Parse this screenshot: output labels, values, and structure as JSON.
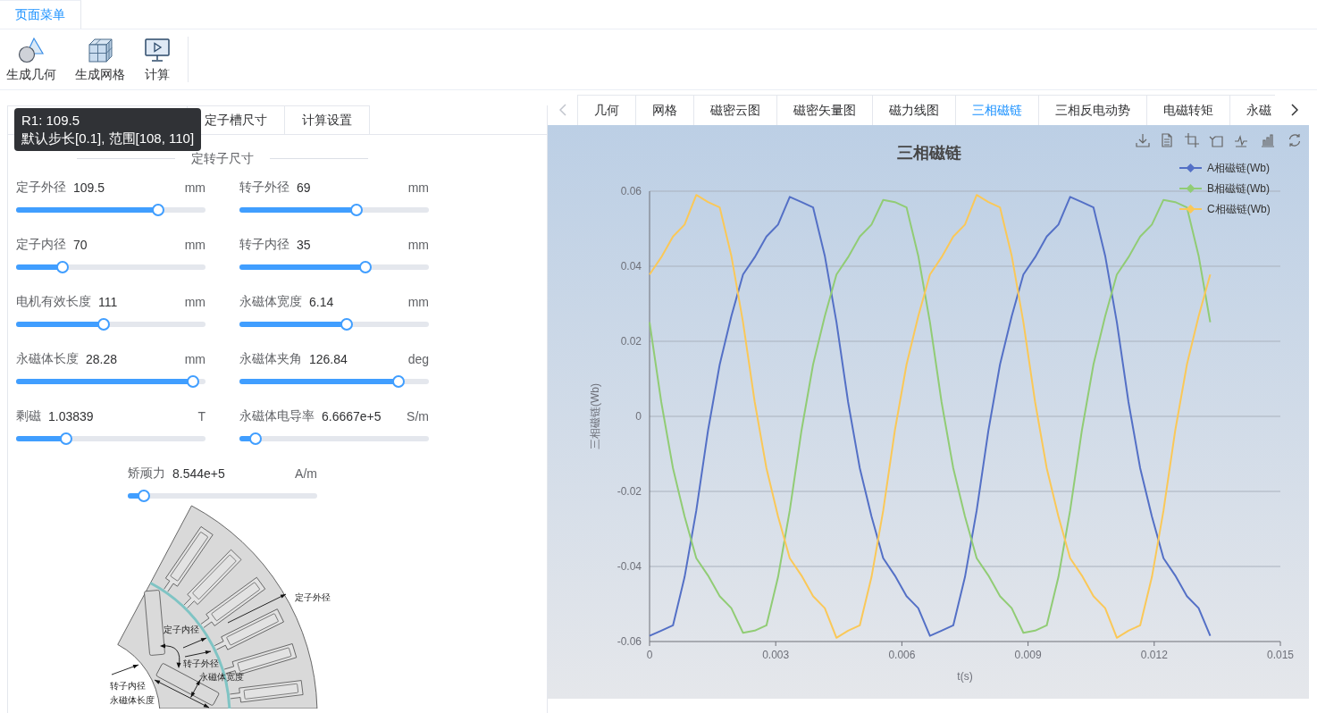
{
  "menu_tabs": [
    {
      "label": "页面菜单",
      "selected": true
    }
  ],
  "toolbar": [
    {
      "kind": "geometry",
      "label": "生成几何"
    },
    {
      "kind": "mesh",
      "label": "生成网格"
    },
    {
      "kind": "compute",
      "label": "计算"
    }
  ],
  "left_panel": {
    "tabs": [
      {
        "label": "定子槽尺寸",
        "selected": false
      },
      {
        "label": "计算设置",
        "selected": false
      }
    ],
    "tooltip": {
      "title": "R1: 109.5",
      "text": "默认步长[0.1], 范围[108, 110]"
    },
    "section_title": "定转子尺寸",
    "sliders": [
      {
        "name": "定子外径",
        "value": "109.5",
        "unit": "mm",
        "level": 0.75
      },
      {
        "name": "转子外径",
        "value": "69",
        "unit": "mm",
        "level": 0.62
      },
      {
        "name": "定子内径",
        "value": "70",
        "unit": "mm",
        "level": 0.245
      },
      {
        "name": "转子内径",
        "value": "35",
        "unit": "mm",
        "level": 0.665
      },
      {
        "name": "电机有效长度",
        "value": "111",
        "unit": "mm",
        "level": 0.46
      },
      {
        "name": "永磁体宽度",
        "value": "6.14",
        "unit": "mm",
        "level": 0.566
      },
      {
        "name": "永磁体长度",
        "value": "28.28",
        "unit": "mm",
        "level": 0.934
      },
      {
        "name": "永磁体夹角",
        "value": "126.84",
        "unit": "deg",
        "level": 0.84
      },
      {
        "name": "剩磁",
        "value": "1.03839",
        "unit": "T",
        "level": 0.264
      },
      {
        "name": "永磁体电导率",
        "value": "6.6667e+5",
        "unit": "S/m",
        "level": 0.085
      },
      {
        "name": "矫顽力",
        "value": "8.544e+5",
        "unit": "A/m",
        "level": 0.085
      }
    ],
    "diagram": {
      "labels": [
        "定子外径",
        "定子内径",
        "转子外径",
        "转子内径",
        "永磁体宽度",
        "永磁体长度"
      ]
    }
  },
  "right_panel": {
    "tab_scroll": {
      "left_disabled": true,
      "right_disabled": false
    },
    "tabs": [
      {
        "label": "几何",
        "selected": false
      },
      {
        "label": "网格",
        "selected": false
      },
      {
        "label": "磁密云图",
        "selected": false
      },
      {
        "label": "磁密矢量图",
        "selected": false
      },
      {
        "label": "磁力线图",
        "selected": false
      },
      {
        "label": "三相磁链",
        "selected": true
      },
      {
        "label": "三相反电动势",
        "selected": false
      },
      {
        "label": "电磁转矩",
        "selected": false
      },
      {
        "label": "永磁",
        "selected": false
      }
    ],
    "chart": {
      "chart_data": {
        "type": "line",
        "title": "三相磁链",
        "xlabel": "t(s)",
        "ylabel": "三相磁链(Wb)",
        "grid": true,
        "legend": "upper right",
        "x": [
          0,
          0.000278,
          0.000556,
          0.000833,
          0.001111,
          0.001389,
          0.001667,
          0.001944,
          0.002222,
          0.0025,
          0.002778,
          0.003056,
          0.003333,
          0.003611,
          0.003889,
          0.004167,
          0.004444,
          0.004722,
          0.005,
          0.005278,
          0.005556,
          0.005833,
          0.006111,
          0.006389,
          0.006667,
          0.006944,
          0.007222,
          0.0075,
          0.007778,
          0.008056,
          0.008333,
          0.008611,
          0.008889,
          0.009167,
          0.009444,
          0.009722,
          0.01,
          0.010278,
          0.010556,
          0.010833,
          0.011111,
          0.011389,
          0.011667,
          0.011944,
          0.012222,
          0.0125,
          0.012778,
          0.013056,
          0.013333
        ],
        "series": [
          {
            "name": "A相磁链(Wb)",
            "color": "#5470c6",
            "values": [
              -0.0585,
              -0.0571,
              -0.0557,
              -0.0428,
              -0.0251,
              -0.0038,
              0.0138,
              0.0267,
              0.0378,
              0.0424,
              0.0479,
              0.0511,
              0.0585,
              0.0571,
              0.0557,
              0.0428,
              0.0251,
              0.0038,
              -0.0138,
              -0.0267,
              -0.0378,
              -0.0424,
              -0.0479,
              -0.0511,
              -0.0585,
              -0.0571,
              -0.0557,
              -0.0428,
              -0.0251,
              -0.0038,
              0.0138,
              0.0267,
              0.0378,
              0.0424,
              0.0479,
              0.0511,
              0.0585,
              0.0571,
              0.0557,
              0.0428,
              0.0251,
              0.0038,
              -0.0138,
              -0.0267,
              -0.0378,
              -0.0424,
              -0.0479,
              -0.0511,
              -0.0585
            ]
          },
          {
            "name": "B相磁链(Wb)",
            "color": "#91cc75",
            "values": [
              0.0251,
              0.0038,
              -0.0138,
              -0.0267,
              -0.0378,
              -0.0424,
              -0.0479,
              -0.0511,
              -0.0577,
              -0.0571,
              -0.0557,
              -0.0428,
              -0.0251,
              -0.0038,
              0.0138,
              0.0267,
              0.0378,
              0.0424,
              0.0479,
              0.0511,
              0.0577,
              0.0571,
              0.0557,
              0.0428,
              0.0251,
              0.0038,
              -0.0138,
              -0.0267,
              -0.0378,
              -0.0424,
              -0.0479,
              -0.0511,
              -0.0577,
              -0.0571,
              -0.0557,
              -0.0428,
              -0.0251,
              -0.0038,
              0.0138,
              0.0267,
              0.0378,
              0.0424,
              0.0479,
              0.0511,
              0.0577,
              0.0571,
              0.0557,
              0.0428,
              0.0251
            ]
          },
          {
            "name": "C相磁链(Wb)",
            "color": "#fac858",
            "values": [
              0.0378,
              0.0424,
              0.0479,
              0.0511,
              0.059,
              0.0571,
              0.0557,
              0.0428,
              0.0251,
              0.0038,
              -0.0138,
              -0.0267,
              -0.0378,
              -0.0424,
              -0.0479,
              -0.0511,
              -0.059,
              -0.0571,
              -0.0557,
              -0.0428,
              -0.0251,
              -0.0038,
              0.0138,
              0.0267,
              0.0378,
              0.0424,
              0.0479,
              0.0511,
              0.059,
              0.0571,
              0.0557,
              0.0428,
              0.0251,
              0.0038,
              -0.0138,
              -0.0267,
              -0.0378,
              -0.0424,
              -0.0479,
              -0.0511,
              -0.059,
              -0.0571,
              -0.0557,
              -0.0428,
              -0.0251,
              -0.0038,
              0.0138,
              0.0267,
              0.0378
            ]
          }
        ],
        "xlim": [
          0,
          0.015
        ],
        "ylim": [
          -0.06,
          0.06
        ],
        "xticks": [
          0,
          0.003,
          0.006,
          0.009,
          0.012,
          0.015
        ],
        "yticks": [
          -0.06,
          -0.04,
          -0.02,
          0,
          0.02,
          0.04,
          0.06
        ]
      }
    }
  }
}
